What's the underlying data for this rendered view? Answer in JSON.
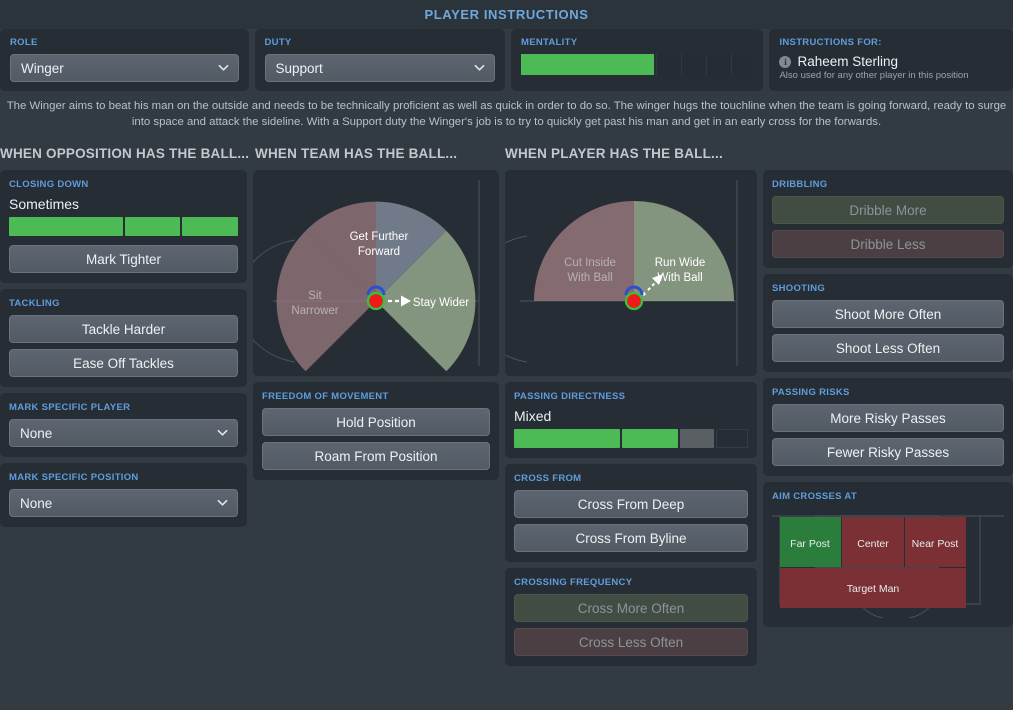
{
  "header": {
    "title": "PLAYER INSTRUCTIONS"
  },
  "top": {
    "role": {
      "label": "ROLE",
      "value": "Winger"
    },
    "duty": {
      "label": "DUTY",
      "value": "Support"
    },
    "mentality": {
      "label": "MENTALITY",
      "filled_segments": 1,
      "total_segments": 6,
      "fill_percent": 55,
      "color": "#4cbb55"
    },
    "instructions_for": {
      "label": "INSTRUCTIONS FOR:",
      "player": "Raheem Sterling",
      "note": "Also used for any other player in this position",
      "icon": "info-icon"
    }
  },
  "description": "The Winger aims to beat his man on the outside and needs to be technically proficient as well as quick in order to do so. The winger hugs the touchline when the team is going forward, ready to surge into space and attack the sideline. With a Support duty the Winger's job is to try to quickly get past his man and get in an early cross for the forwards.",
  "columns": {
    "opposition": "WHEN OPPOSITION HAS THE BALL...",
    "team": "WHEN TEAM HAS THE BALL...",
    "player": "WHEN PLAYER HAS THE BALL..."
  },
  "closing_down": {
    "label": "CLOSING DOWN",
    "value": "Sometimes",
    "segments": [
      true,
      true,
      true,
      false,
      false
    ],
    "button": "Mark Tighter"
  },
  "tackling": {
    "label": "TACKLING",
    "buttons": [
      "Tackle Harder",
      "Ease Off Tackles"
    ]
  },
  "mark_specific_player": {
    "label": "MARK SPECIFIC PLAYER",
    "value": "None"
  },
  "mark_specific_position": {
    "label": "MARK SPECIFIC POSITION",
    "value": "None"
  },
  "team_wheel": {
    "top": "Get Further\nForward",
    "top_line1": "Get Further",
    "top_line2": "Forward",
    "left_line1": "Sit",
    "left_line2": "Narrower",
    "right": "Stay Wider",
    "selected": "Stay Wider",
    "arrow_direction": "right"
  },
  "player_wheel": {
    "left_line1": "Cut Inside",
    "left_line2": "With Ball",
    "right_line1": "Run Wide",
    "right_line2": "With Ball",
    "selected": "Run Wide With Ball",
    "arrow_direction": "up-right"
  },
  "freedom_of_movement": {
    "label": "FREEDOM OF MOVEMENT",
    "buttons": [
      "Hold Position",
      "Roam From Position"
    ]
  },
  "passing_directness": {
    "label": "PASSING DIRECTNESS",
    "value": "Mixed",
    "segments": [
      "on",
      "on",
      "grey",
      "off"
    ]
  },
  "cross_from": {
    "label": "CROSS FROM",
    "buttons": [
      "Cross From Deep",
      "Cross From Byline"
    ]
  },
  "crossing_frequency": {
    "label": "CROSSING FREQUENCY",
    "more": "Cross More Often",
    "less": "Cross Less Often"
  },
  "dribbling": {
    "label": "DRIBBLING",
    "more": "Dribble More",
    "less": "Dribble Less"
  },
  "shooting": {
    "label": "SHOOTING",
    "buttons": [
      "Shoot More Often",
      "Shoot Less Often"
    ]
  },
  "passing_risks": {
    "label": "PASSING RISKS",
    "buttons": [
      "More Risky Passes",
      "Fewer Risky Passes"
    ]
  },
  "aim_crosses_at": {
    "label": "AIM CROSSES AT",
    "zones": [
      {
        "name": "Far Post",
        "state": "selected"
      },
      {
        "name": "Center",
        "state": "unselected"
      },
      {
        "name": "Near Post",
        "state": "unselected"
      },
      {
        "name": "Target Man",
        "state": "unselected"
      }
    ],
    "selected_color": "#2b7d3c",
    "unselected_color": "#7a3034"
  },
  "colors": {
    "accent": "#5f9ddb",
    "green": "#4cbb55",
    "background": "#323a42",
    "panel": "#262d35"
  }
}
